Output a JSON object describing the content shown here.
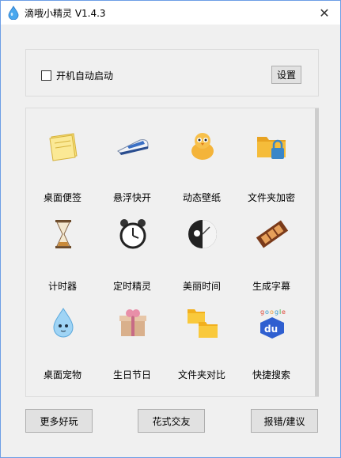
{
  "window": {
    "title": "滴哦小精灵 V1.4.3",
    "close_glyph": "✕"
  },
  "startup": {
    "checkbox_label": "开机自动启动",
    "checked": false,
    "settings_label": "设置"
  },
  "tools": [
    {
      "label": "桌面便签",
      "icon": "sticky-note-icon"
    },
    {
      "label": "悬浮快开",
      "icon": "bullet-train-icon"
    },
    {
      "label": "动态壁纸",
      "icon": "chick-icon"
    },
    {
      "label": "文件夹加密",
      "icon": "locked-folder-icon"
    },
    {
      "label": "计时器",
      "icon": "hourglass-icon"
    },
    {
      "label": "定时精灵",
      "icon": "alarm-clock-icon"
    },
    {
      "label": "美丽时间",
      "icon": "artistic-clock-icon"
    },
    {
      "label": "生成字幕",
      "icon": "film-strip-icon"
    },
    {
      "label": "桌面宠物",
      "icon": "water-drop-pet-icon"
    },
    {
      "label": "生日节日",
      "icon": "gift-box-icon"
    },
    {
      "label": "文件夹对比",
      "icon": "folder-compare-icon"
    },
    {
      "label": "快捷搜索",
      "icon": "baidu-search-icon"
    }
  ],
  "footer": {
    "more_fun_label": "更多好玩",
    "friends_label": "花式交友",
    "feedback_label": "报错/建议"
  },
  "colors": {
    "accent": "#6d9ee6",
    "panel_bg": "#f0f0f0",
    "button_bg": "#e1e1e1"
  }
}
